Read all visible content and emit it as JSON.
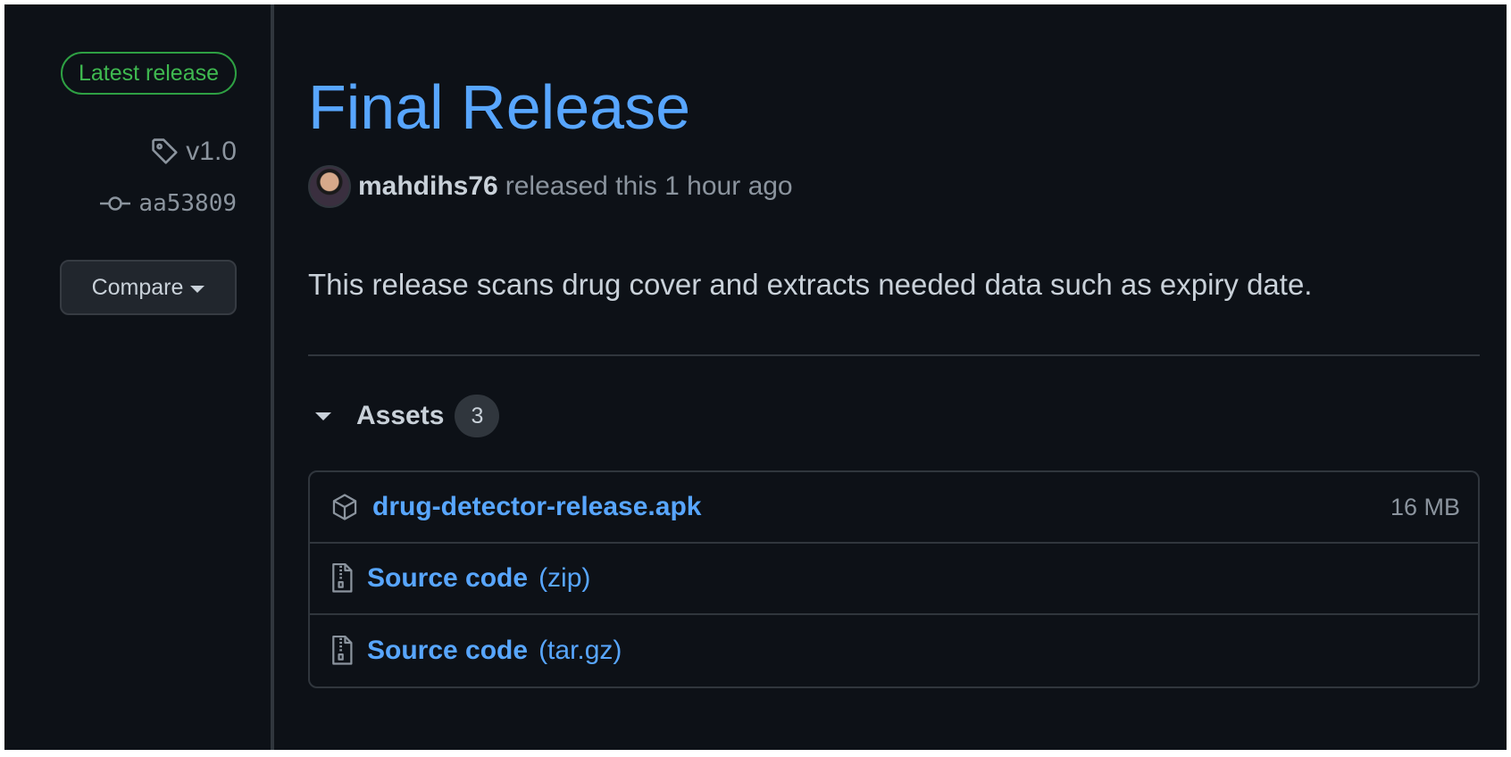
{
  "sidebar": {
    "latest_badge": "Latest release",
    "tag": "v1.0",
    "commit": "aa53809",
    "compare_label": "Compare"
  },
  "release": {
    "title": "Final Release",
    "author": "mahdihs76",
    "released_text": "released this 1 hour ago",
    "description": "This release scans drug cover and extracts needed data such as expiry date."
  },
  "assets": {
    "label": "Assets",
    "count": "3",
    "items": [
      {
        "name": "drug-detector-release.apk",
        "suffix": "",
        "size": "16 MB",
        "icon": "package-icon"
      },
      {
        "name": "Source code",
        "suffix": "(zip)",
        "size": "",
        "icon": "file-zip-icon"
      },
      {
        "name": "Source code",
        "suffix": "(tar.gz)",
        "size": "",
        "icon": "file-zip-icon"
      }
    ]
  },
  "colors": {
    "background": "#0d1117",
    "link": "#58a6ff",
    "latest_green": "#3fb950",
    "muted": "#8b949e",
    "border": "#30363d"
  }
}
